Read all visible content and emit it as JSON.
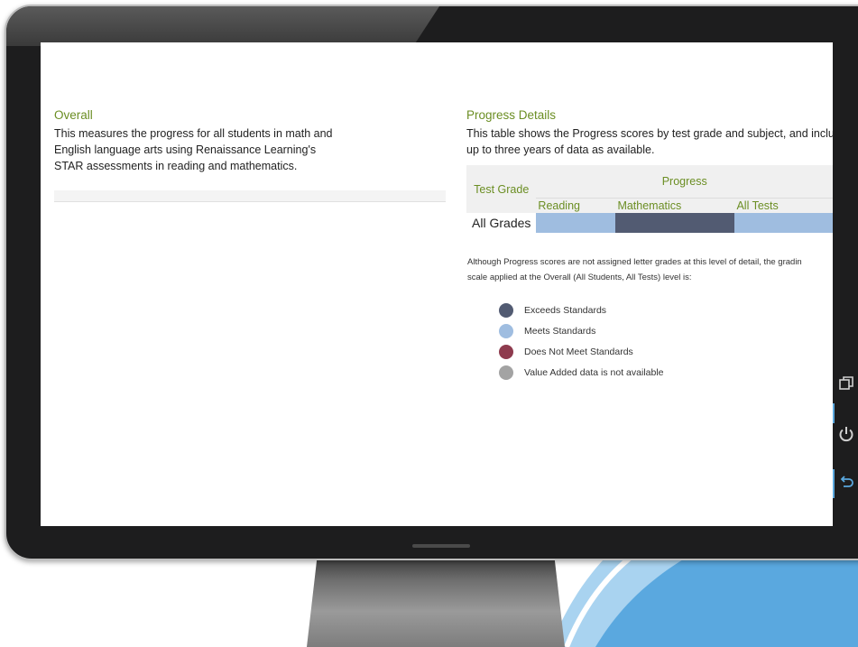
{
  "overall": {
    "title": "Overall",
    "description_lines": [
      "This measures the progress for all students in math and",
      "English language arts using Renaissance Learning's",
      "STAR assessments in reading and mathematics."
    ]
  },
  "progress_details": {
    "title": "Progress Details",
    "description_lines": [
      "This table shows the Progress scores by test grade and subject, and inclu",
      "up to three years of data as available."
    ],
    "table": {
      "grade_header": "Test Grade",
      "group_header": "Progress",
      "sub_headers": [
        "Reading",
        "Mathematics",
        "All Tests"
      ],
      "rows": [
        {
          "grade": "All Grades",
          "cells": [
            "Meets Standards",
            "Exceeds Standards",
            "Meets Standards"
          ]
        }
      ]
    },
    "note_lines": [
      "Although Progress scores are not assigned letter grades at this level of detail, the gradin",
      "scale applied at the Overall (All Students, All Tests) level is:"
    ]
  },
  "legend": {
    "items": [
      {
        "label": "Exceeds Standards",
        "color": "#525b72"
      },
      {
        "label": "Meets Standards",
        "color": "#9fbde0"
      },
      {
        "label": "Does Not Meet Standards",
        "color": "#8e3b4e"
      },
      {
        "label": "Value Added data is not available",
        "color": "#a3a3a3"
      }
    ]
  },
  "colors": {
    "accent_green": "#6b8e23",
    "swoosh_blue": "#5aa8df",
    "bezel": "#1d1d1e"
  },
  "icons": {
    "side_buttons": [
      "restore-window-icon",
      "power-icon",
      "back-arrow-icon"
    ]
  }
}
